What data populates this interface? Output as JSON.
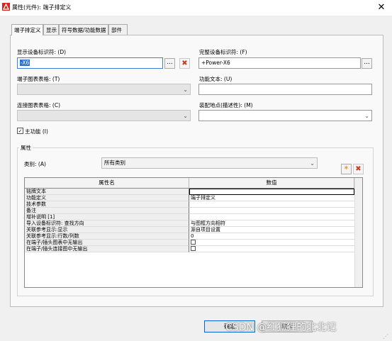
{
  "window": {
    "title": "属性(元件): 端子排定义"
  },
  "tabs": [
    {
      "label": "端子排定义"
    },
    {
      "label": "显示"
    },
    {
      "label": "符号数据/功能数据"
    },
    {
      "label": "部件"
    }
  ],
  "fields": {
    "display_id_label": "显示设备标识符: (D)",
    "display_id_value": "-X6",
    "full_id_label": "完整设备标识符: (F)",
    "full_id_value": "+Power-X6",
    "terminal_chart_label": "端子图表表格: (T)",
    "function_text_label": "功能文本: (U)",
    "function_text_value": "",
    "connection_chart_label": "连接图表表格: (C)",
    "mount_location_label": "装配地点(描述性): (M)",
    "mount_location_value": ""
  },
  "main_function": {
    "label": "主功能 (I)",
    "checked": true
  },
  "properties": {
    "group_label": "属性",
    "category_label": "类别: (A)",
    "category_value": "所有类别",
    "col_name": "属性名",
    "col_value": "数值",
    "rows": [
      {
        "name": "铭牌文本",
        "value": ""
      },
      {
        "name": "功能定义",
        "value": "端子排定义"
      },
      {
        "name": "技术参数",
        "value": ""
      },
      {
        "name": "备注",
        "value": ""
      },
      {
        "name": "增补说明 [1]",
        "value": ""
      },
      {
        "name": "导入设备标识符: 查找方向",
        "value": "与图框方向相符"
      },
      {
        "name": "关联参考显示:显示",
        "value": "源自项目设置"
      },
      {
        "name": "关联参考显示:行数/列数",
        "value": "0"
      },
      {
        "name": "在端子/插头图表中无输出",
        "value": ""
      },
      {
        "name": "在端子/插头连接图中无输出",
        "value": ""
      }
    ]
  },
  "buttons": {
    "ok": "确定",
    "cancel": "取消"
  },
  "watermark": "CSDN @红狐狸的北北记",
  "icons": {
    "star": "✶",
    "delete": "✖",
    "browse": "...",
    "chevron": "⌄",
    "close": "✕"
  }
}
